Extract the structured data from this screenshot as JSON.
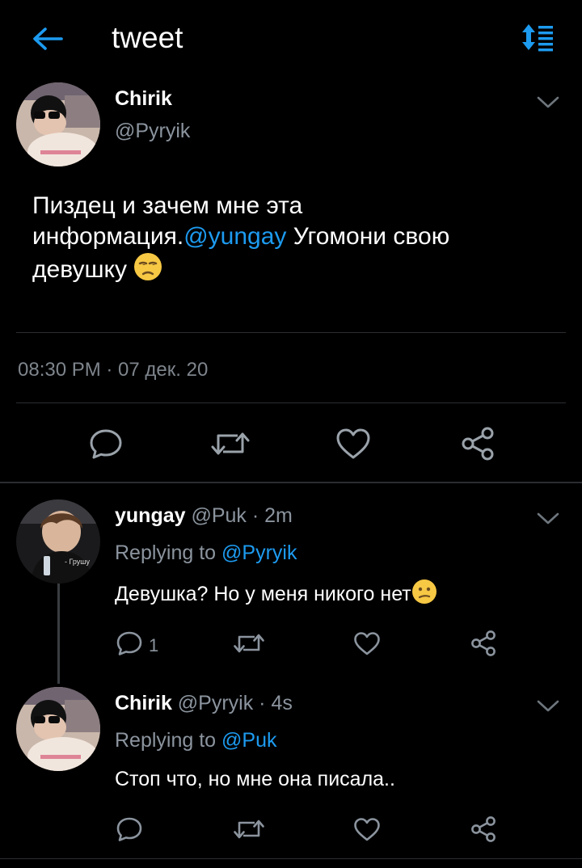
{
  "header": {
    "title": "tweet",
    "back_icon": "arrow-left-icon",
    "sort_icon": "sort-icon",
    "accent": "#1d9bf0"
  },
  "main_tweet": {
    "display_name": "Chirik",
    "handle": "@Pyryik",
    "text_before": "Пиздец и зачем мне эта информация.",
    "mention": "@yungay",
    "text_after": " Угомони свою девушку ",
    "emoji": "unamused-face-emoji",
    "timestamp": "08:30 PM · 07 дек. 20"
  },
  "replies": [
    {
      "display_name": "yungay",
      "meta": " @Puk · 2m",
      "replying_prefix": "Replying to ",
      "replying_handle": "@Pyryik",
      "text": "Девушка? Но у меня никого нет",
      "emoji": "confused-face-emoji",
      "reply_count": "1"
    },
    {
      "display_name": "Chirik",
      "meta": " @Pyryik · 4s",
      "replying_prefix": "Replying to ",
      "replying_handle": "@Puk",
      "text": "Стоп что, но мне она писала.."
    }
  ]
}
